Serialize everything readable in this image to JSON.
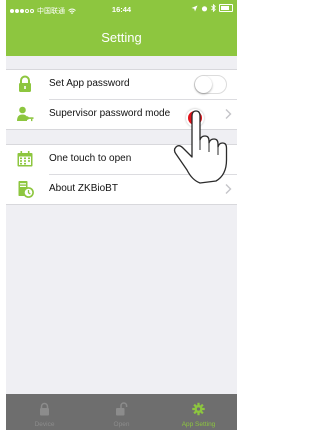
{
  "status_bar": {
    "carrier": "中国联通",
    "time": "16:44"
  },
  "header": {
    "title": "Setting"
  },
  "settings": [
    {
      "label": "Set App password",
      "control": "toggle",
      "on": false,
      "icon": "lock-icon"
    },
    {
      "label": "Supervisor password mode",
      "control": "chevron",
      "icon": "user-key-icon"
    },
    {
      "label": "One touch to open",
      "control": "toggle",
      "on": false,
      "icon": "calendar-icon"
    },
    {
      "label": "About ZKBioBT",
      "control": "chevron",
      "icon": "info-doc-icon"
    }
  ],
  "tabs": [
    {
      "label": "Device",
      "icon": "lock-icon",
      "active": false
    },
    {
      "label": "Open",
      "icon": "unlock-icon",
      "active": false
    },
    {
      "label": "App Setting",
      "icon": "gear-icon",
      "active": true
    }
  ],
  "colors": {
    "brand_green": "#8dc63f",
    "tab_bar": "#6e6e6e",
    "tap_indicator": "#e2141b",
    "background": "#efeff3"
  }
}
